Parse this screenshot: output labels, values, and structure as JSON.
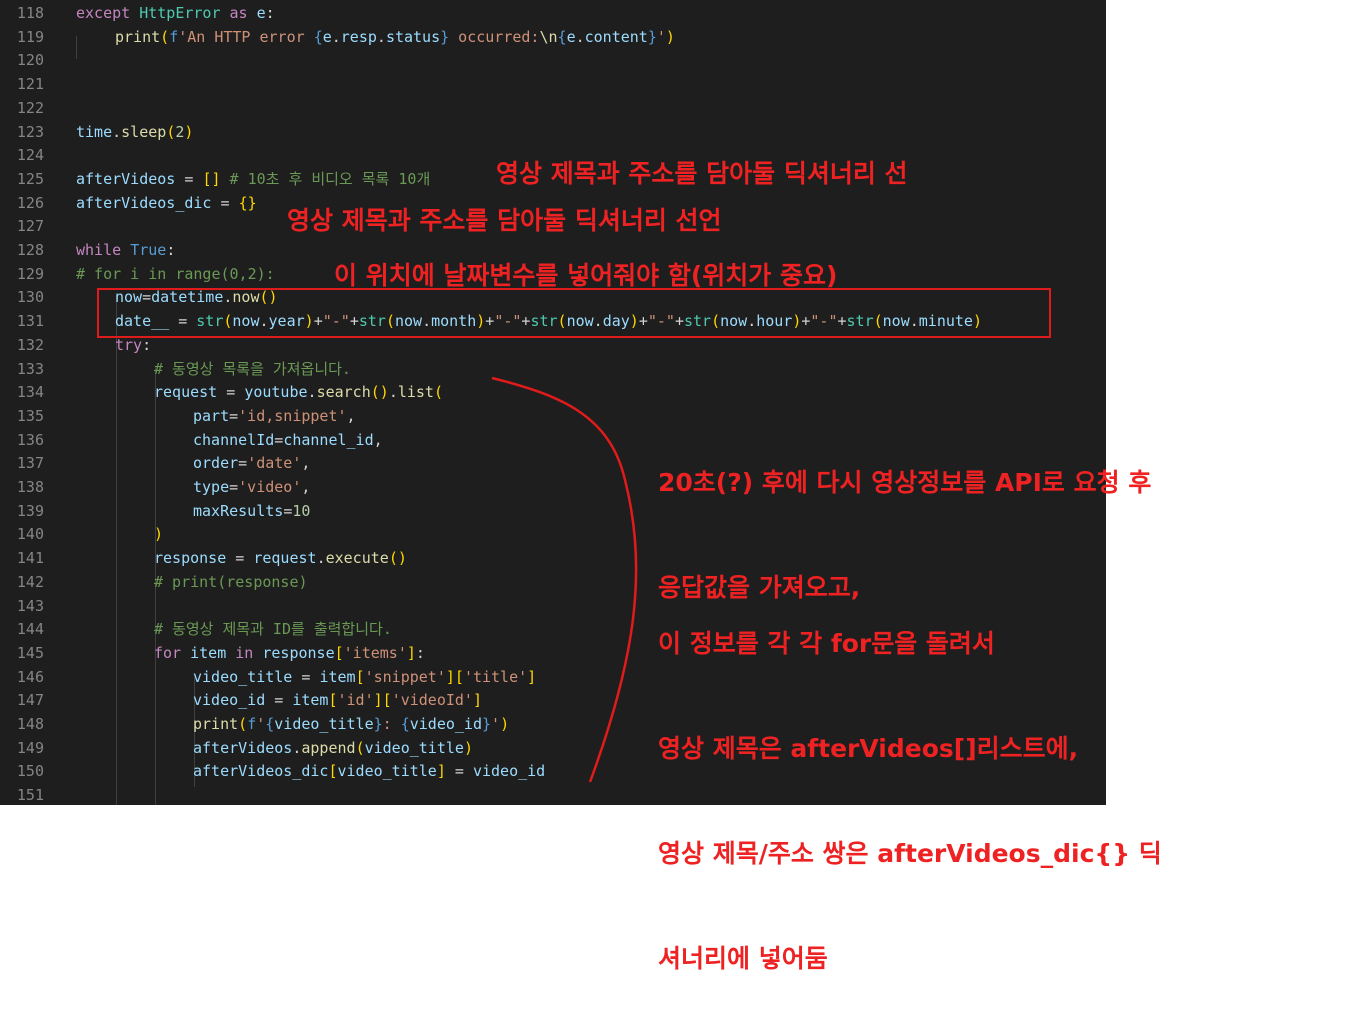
{
  "editor": {
    "lines": [
      {
        "n": "118",
        "indent": 0,
        "tokens": [
          [
            "kw",
            "except "
          ],
          [
            "bl",
            "HttpError"
          ],
          [
            "kw",
            " as "
          ],
          [
            "vr",
            "e"
          ],
          [
            "pu",
            ":"
          ]
        ]
      },
      {
        "n": "119",
        "indent": 1,
        "tokens": [
          [
            "fn",
            "print"
          ],
          [
            "br1",
            "("
          ],
          [
            "k2",
            "f"
          ],
          [
            "st",
            "'An HTTP error "
          ],
          [
            "k2",
            "{"
          ],
          [
            "vr",
            "e"
          ],
          [
            "pu",
            "."
          ],
          [
            "vr",
            "resp"
          ],
          [
            "pu",
            "."
          ],
          [
            "vr",
            "status"
          ],
          [
            "k2",
            "}"
          ],
          [
            "st",
            " occurred:"
          ],
          [
            "fn",
            "\\n"
          ],
          [
            "k2",
            "{"
          ],
          [
            "vr",
            "e"
          ],
          [
            "pu",
            "."
          ],
          [
            "vr",
            "content"
          ],
          [
            "k2",
            "}"
          ],
          [
            "st",
            "'"
          ],
          [
            "br1",
            ")"
          ]
        ]
      },
      {
        "n": "120",
        "indent": 0,
        "tokens": []
      },
      {
        "n": "121",
        "indent": 0,
        "tokens": []
      },
      {
        "n": "122",
        "indent": 0,
        "tokens": []
      },
      {
        "n": "123",
        "indent": 0,
        "tokens": [
          [
            "vr",
            "time"
          ],
          [
            "pu",
            "."
          ],
          [
            "fn",
            "sleep"
          ],
          [
            "br1",
            "("
          ],
          [
            "nm",
            "2"
          ],
          [
            "br1",
            ")"
          ]
        ]
      },
      {
        "n": "124",
        "indent": 0,
        "tokens": []
      },
      {
        "n": "125",
        "indent": 0,
        "tokens": [
          [
            "vr",
            "afterVideos"
          ],
          [
            "pu",
            " = "
          ],
          [
            "br1",
            "[]"
          ],
          [
            "cm",
            " # 10초 후 비디오 목록 10개"
          ]
        ]
      },
      {
        "n": "126",
        "indent": 0,
        "tokens": [
          [
            "vr",
            "afterVideos_dic"
          ],
          [
            "pu",
            " = "
          ],
          [
            "br1",
            "{}"
          ]
        ]
      },
      {
        "n": "127",
        "indent": 0,
        "tokens": []
      },
      {
        "n": "128",
        "indent": 0,
        "tokens": [
          [
            "kw",
            "while "
          ],
          [
            "k2",
            "True"
          ],
          [
            "pu",
            ":"
          ]
        ]
      },
      {
        "n": "129",
        "indent": 0,
        "tokens": [
          [
            "cm",
            "# for i in range(0,2):"
          ]
        ]
      },
      {
        "n": "130",
        "indent": 1,
        "tokens": [
          [
            "vr",
            "now"
          ],
          [
            "pu",
            "="
          ],
          [
            "vr",
            "datetime"
          ],
          [
            "pu",
            "."
          ],
          [
            "fn",
            "now"
          ],
          [
            "br1",
            "()"
          ]
        ]
      },
      {
        "n": "131",
        "indent": 1,
        "tokens": [
          [
            "vr",
            "date__"
          ],
          [
            "pu",
            " = "
          ],
          [
            "bl",
            "str"
          ],
          [
            "br1",
            "("
          ],
          [
            "vr",
            "now"
          ],
          [
            "pu",
            "."
          ],
          [
            "vr",
            "year"
          ],
          [
            "br1",
            ")"
          ],
          [
            "pu",
            "+"
          ],
          [
            "st",
            "\"-\""
          ],
          [
            "pu",
            "+"
          ],
          [
            "bl",
            "str"
          ],
          [
            "br1",
            "("
          ],
          [
            "vr",
            "now"
          ],
          [
            "pu",
            "."
          ],
          [
            "vr",
            "month"
          ],
          [
            "br1",
            ")"
          ],
          [
            "pu",
            "+"
          ],
          [
            "st",
            "\"-\""
          ],
          [
            "pu",
            "+"
          ],
          [
            "bl",
            "str"
          ],
          [
            "br1",
            "("
          ],
          [
            "vr",
            "now"
          ],
          [
            "pu",
            "."
          ],
          [
            "vr",
            "day"
          ],
          [
            "br1",
            ")"
          ],
          [
            "pu",
            "+"
          ],
          [
            "st",
            "\"-\""
          ],
          [
            "pu",
            "+"
          ],
          [
            "bl",
            "str"
          ],
          [
            "br1",
            "("
          ],
          [
            "vr",
            "now"
          ],
          [
            "pu",
            "."
          ],
          [
            "vr",
            "hour"
          ],
          [
            "br1",
            ")"
          ],
          [
            "pu",
            "+"
          ],
          [
            "st",
            "\"-\""
          ],
          [
            "pu",
            "+"
          ],
          [
            "bl",
            "str"
          ],
          [
            "br1",
            "("
          ],
          [
            "vr",
            "now"
          ],
          [
            "pu",
            "."
          ],
          [
            "vr",
            "minute"
          ],
          [
            "br1",
            ")"
          ]
        ]
      },
      {
        "n": "132",
        "indent": 1,
        "tokens": [
          [
            "kw",
            "try"
          ],
          [
            "pu",
            ":"
          ]
        ]
      },
      {
        "n": "133",
        "indent": 2,
        "tokens": [
          [
            "cm",
            "# 동영상 목록을 가져옵니다."
          ]
        ]
      },
      {
        "n": "134",
        "indent": 2,
        "tokens": [
          [
            "vr",
            "request"
          ],
          [
            "pu",
            " = "
          ],
          [
            "vr",
            "youtube"
          ],
          [
            "pu",
            "."
          ],
          [
            "fn",
            "search"
          ],
          [
            "br1",
            "()"
          ],
          [
            "pu",
            "."
          ],
          [
            "fn",
            "list"
          ],
          [
            "br1",
            "("
          ]
        ]
      },
      {
        "n": "135",
        "indent": 3,
        "tokens": [
          [
            "vr",
            "part"
          ],
          [
            "pu",
            "="
          ],
          [
            "st",
            "'id,snippet'"
          ],
          [
            "pu",
            ","
          ]
        ]
      },
      {
        "n": "136",
        "indent": 3,
        "tokens": [
          [
            "vr",
            "channelId"
          ],
          [
            "pu",
            "="
          ],
          [
            "vr",
            "channel_id"
          ],
          [
            "pu",
            ","
          ]
        ]
      },
      {
        "n": "137",
        "indent": 3,
        "tokens": [
          [
            "vr",
            "order"
          ],
          [
            "pu",
            "="
          ],
          [
            "st",
            "'date'"
          ],
          [
            "pu",
            ","
          ]
        ]
      },
      {
        "n": "138",
        "indent": 3,
        "tokens": [
          [
            "vr",
            "type"
          ],
          [
            "pu",
            "="
          ],
          [
            "st",
            "'video'"
          ],
          [
            "pu",
            ","
          ]
        ]
      },
      {
        "n": "139",
        "indent": 3,
        "tokens": [
          [
            "vr",
            "maxResults"
          ],
          [
            "pu",
            "="
          ],
          [
            "nm",
            "10"
          ]
        ]
      },
      {
        "n": "140",
        "indent": 2,
        "tokens": [
          [
            "br1",
            ")"
          ]
        ]
      },
      {
        "n": "141",
        "indent": 2,
        "tokens": [
          [
            "vr",
            "response"
          ],
          [
            "pu",
            " = "
          ],
          [
            "vr",
            "request"
          ],
          [
            "pu",
            "."
          ],
          [
            "fn",
            "execute"
          ],
          [
            "br1",
            "()"
          ]
        ]
      },
      {
        "n": "142",
        "indent": 2,
        "tokens": [
          [
            "cm",
            "# print(response)"
          ]
        ]
      },
      {
        "n": "143",
        "indent": 0,
        "tokens": []
      },
      {
        "n": "144",
        "indent": 2,
        "tokens": [
          [
            "cm",
            "# 동영상 제목과 ID를 출력합니다."
          ]
        ]
      },
      {
        "n": "145",
        "indent": 2,
        "tokens": [
          [
            "kw",
            "for "
          ],
          [
            "vr",
            "item"
          ],
          [
            "kw",
            " in "
          ],
          [
            "vr",
            "response"
          ],
          [
            "br1",
            "["
          ],
          [
            "st",
            "'items'"
          ],
          [
            "br1",
            "]"
          ],
          [
            "pu",
            ":"
          ]
        ]
      },
      {
        "n": "146",
        "indent": 3,
        "tokens": [
          [
            "vr",
            "video_title"
          ],
          [
            "pu",
            " = "
          ],
          [
            "vr",
            "item"
          ],
          [
            "br1",
            "["
          ],
          [
            "st",
            "'snippet'"
          ],
          [
            "br1",
            "]["
          ],
          [
            "st",
            "'title'"
          ],
          [
            "br1",
            "]"
          ]
        ]
      },
      {
        "n": "147",
        "indent": 3,
        "tokens": [
          [
            "vr",
            "video_id"
          ],
          [
            "pu",
            " = "
          ],
          [
            "vr",
            "item"
          ],
          [
            "br1",
            "["
          ],
          [
            "st",
            "'id'"
          ],
          [
            "br1",
            "]["
          ],
          [
            "st",
            "'videoId'"
          ],
          [
            "br1",
            "]"
          ]
        ]
      },
      {
        "n": "148",
        "indent": 3,
        "tokens": [
          [
            "fn",
            "print"
          ],
          [
            "br1",
            "("
          ],
          [
            "k2",
            "f"
          ],
          [
            "st",
            "'"
          ],
          [
            "k2",
            "{"
          ],
          [
            "vr",
            "video_title"
          ],
          [
            "k2",
            "}"
          ],
          [
            "st",
            ": "
          ],
          [
            "k2",
            "{"
          ],
          [
            "vr",
            "video_id"
          ],
          [
            "k2",
            "}"
          ],
          [
            "st",
            "'"
          ],
          [
            "br1",
            ")"
          ]
        ]
      },
      {
        "n": "149",
        "indent": 3,
        "tokens": [
          [
            "vr",
            "afterVideos"
          ],
          [
            "pu",
            "."
          ],
          [
            "fn",
            "append"
          ],
          [
            "br1",
            "("
          ],
          [
            "vr",
            "video_title"
          ],
          [
            "br1",
            ")"
          ]
        ]
      },
      {
        "n": "150",
        "indent": 3,
        "tokens": [
          [
            "vr",
            "afterVideos_dic"
          ],
          [
            "br1",
            "["
          ],
          [
            "vr",
            "video_title"
          ],
          [
            "br1",
            "]"
          ],
          [
            "pu",
            " = "
          ],
          [
            "vr",
            "video_id"
          ]
        ]
      },
      {
        "n": "151",
        "indent": 0,
        "tokens": []
      }
    ]
  },
  "annotations": {
    "note1": "영상 제목과 주소를 담아둘 딕셔너리 선",
    "note2": "영상 제목과 주소를 담아둘 딕셔너리 선언",
    "note3": "이 위치에 날짜변수를 넣어줘야 함(위치가 중요)",
    "note4_l1": "20초(?) 후에 다시 영상정보를 API로 요청 후",
    "note4_l2": "응답값을 가져오고,",
    "note5_l1": "이 정보를 각 각 for문을 돌려서",
    "note5_l2": "영상 제목은 afterVideos[]리스트에,",
    "note5_l3": "영상 제목/주소 쌍은 afterVideos_dic{} 딕",
    "note5_l4": "셔너리에 넣어둠",
    "accent_color": "#ee2222"
  },
  "theme": {
    "editor_bg": "#1e1e1e",
    "line_number_color": "#858585"
  }
}
